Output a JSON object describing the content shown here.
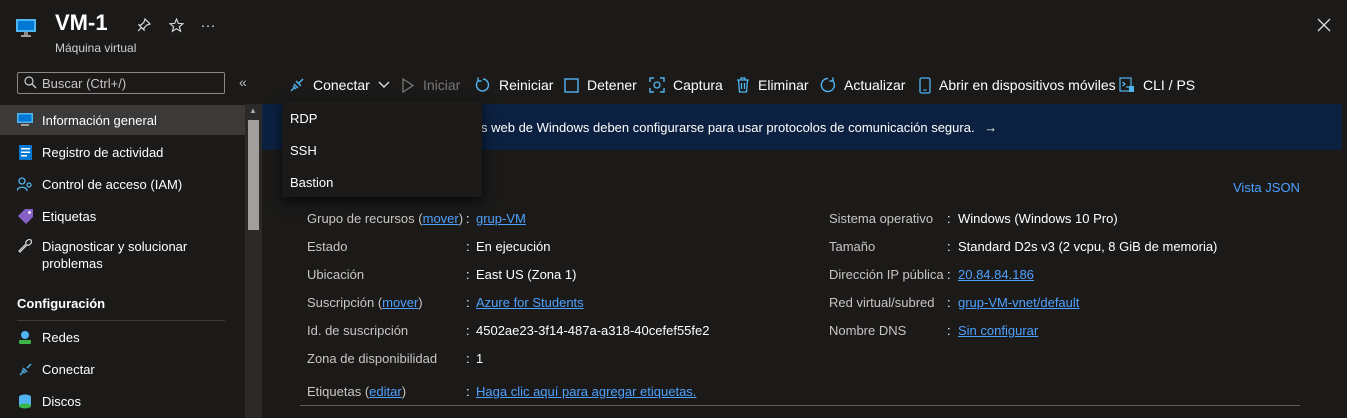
{
  "header": {
    "title": "VM-1",
    "subtitle": "Máquina virtual",
    "more_label": "···"
  },
  "sidebar": {
    "search_placeholder": "Buscar (Ctrl+/)",
    "collapse_label": "«",
    "items": [
      {
        "label": "Información general",
        "icon": "monitor-icon",
        "active": true
      },
      {
        "label": "Registro de actividad",
        "icon": "activity-log-icon"
      },
      {
        "label": "Control de acceso (IAM)",
        "icon": "iam-icon"
      },
      {
        "label": "Etiquetas",
        "icon": "tag-icon"
      },
      {
        "label": "Diagnosticar y solucionar problemas",
        "icon": "wrench-icon"
      }
    ],
    "section_title": "Configuración",
    "config_items": [
      {
        "label": "Redes",
        "icon": "network-icon"
      },
      {
        "label": "Conectar",
        "icon": "connect-icon"
      },
      {
        "label": "Discos",
        "icon": "disk-icon"
      }
    ]
  },
  "toolbar": {
    "connect": "Conectar",
    "start": "Iniciar",
    "restart": "Reiniciar",
    "stop": "Detener",
    "capture": "Captura",
    "delete": "Eliminar",
    "refresh": "Actualizar",
    "mobile": "Abrir en dispositivos móviles",
    "cli": "CLI / PS"
  },
  "dropdown": {
    "items": [
      "RDP",
      "SSH",
      "Bastion"
    ]
  },
  "banner": {
    "text": "s web de Windows deben configurarse para usar protocolos de comunicación segura.",
    "arrow": "→"
  },
  "essentials": {
    "json_view": "Vista JSON",
    "colon": ":",
    "left": {
      "resource_group_label": "Grupo de recursos",
      "resource_group_move": "mover",
      "resource_group_value": "grup-VM",
      "status_label": "Estado",
      "status_value": "En ejecución",
      "location_label": "Ubicación",
      "location_value": "East US (Zona 1)",
      "subscription_label": "Suscripción",
      "subscription_move": "mover",
      "subscription_value": "Azure for Students",
      "subscription_id_label": "Id. de suscripción",
      "subscription_id_value": "4502ae23-3f14-487a-a318-40cefef55fe2",
      "zone_label": "Zona de disponibilidad",
      "zone_value": "1",
      "tags_label": "Etiquetas",
      "tags_edit": "editar",
      "tags_value": "Haga clic aquí para agregar etiquetas."
    },
    "right": {
      "os_label": "Sistema operativo",
      "os_value": "Windows (Windows 10 Pro)",
      "size_label": "Tamaño",
      "size_value": "Standard D2s v3 (2 vcpu, 8 GiB de memoria)",
      "public_ip_label": "Dirección IP pública",
      "public_ip_value": "20.84.84.186",
      "vnet_label": "Red virtual/subred",
      "vnet_value": "grup-VM-vnet/default",
      "dns_label": "Nombre DNS",
      "dns_value": "Sin configurar"
    }
  }
}
